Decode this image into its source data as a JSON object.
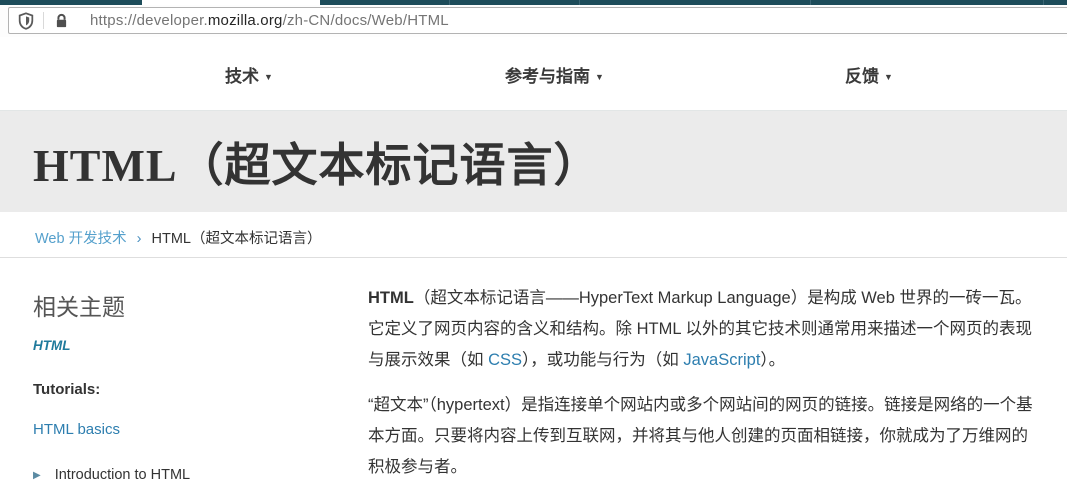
{
  "browser": {
    "url": {
      "prefix": "https://developer.",
      "domain": "mozilla.org",
      "path": "/zh-CN/docs/Web/HTML"
    }
  },
  "nav": {
    "items": [
      {
        "label": "技术",
        "caret": "▼"
      },
      {
        "label": "参考与指南",
        "caret": "▼"
      },
      {
        "label": "反馈",
        "caret": "▼"
      }
    ]
  },
  "header": {
    "title": "HTML（超文本标记语言）"
  },
  "breadcrumb": {
    "link": "Web 开发技术",
    "separator": "›",
    "current": "HTML（超文本标记语言）"
  },
  "sidebar": {
    "heading": "相关主题",
    "topic_link": "HTML",
    "tutorials_label": "Tutorials:",
    "tutorial_link": "HTML basics",
    "list_marker": "▶",
    "list_items": [
      {
        "label": "Introduction to HTML"
      }
    ]
  },
  "main": {
    "paragraphs": [
      {
        "segments": [
          {
            "text": "HTML",
            "style": "bold"
          },
          {
            "text": "（超文本标记语言——HyperText Markup Language）是构成 Web 世界的一砖一瓦。它定义了网页内容的含义和结构。除 HTML 以外的其它技术则通常用来描述一个网页的表现与展示效果（如 ",
            "style": "plain"
          },
          {
            "text": "CSS",
            "style": "link"
          },
          {
            "text": "），或功能与行为（如 ",
            "style": "plain"
          },
          {
            "text": "JavaScript",
            "style": "link"
          },
          {
            "text": "）。",
            "style": "plain"
          }
        ]
      },
      {
        "segments": [
          {
            "text": "“超文本”（hypertext）是指连接单个网站内或多个网站间的网页的链接。链接是网络的一个基本方面。只要将内容上传到互联网，并将其与他人创建的页面相链接，你就成为了万维网的积极参与者。",
            "style": "plain"
          }
        ]
      }
    ]
  },
  "colors": {
    "tabstrip_dark": "#1d4c5a",
    "header_bg": "#ebebeb",
    "breadcrumb_link": "#55a0cc",
    "content_link": "#2d7eaf",
    "sidebar_topic_link": "#1f7a9c",
    "body_text": "#333333"
  }
}
